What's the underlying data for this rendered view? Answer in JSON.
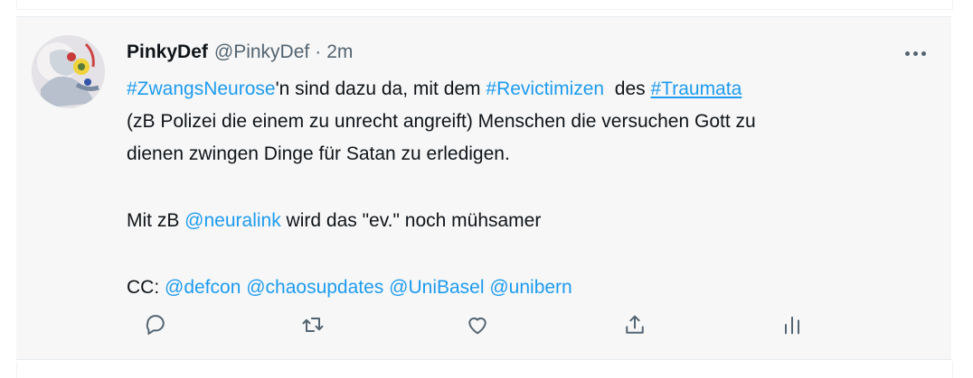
{
  "tweet": {
    "author_name": "PinkyDef",
    "author_handle": "@PinkyDef",
    "separator": "·",
    "time": "2m",
    "lines": [
      {
        "segments": [
          {
            "text": "#ZwangsNeurose",
            "link": true
          },
          {
            "text": "'n sind dazu da, mit dem "
          },
          {
            "text": "#Revictimizen",
            "link": true
          },
          {
            "text": "  des "
          },
          {
            "text": "#Traumata",
            "link": true,
            "underline": true
          }
        ]
      },
      {
        "segments": [
          {
            "text": "(zB Polizei die einem zu unrecht angreift) Menschen die versuchen Gott zu"
          }
        ]
      },
      {
        "segments": [
          {
            "text": "dienen zwingen Dinge für Satan zu erledigen."
          }
        ]
      },
      {
        "segments": []
      },
      {
        "segments": [
          {
            "text": "Mit zB "
          },
          {
            "text": "@neuralink",
            "link": true
          },
          {
            "text": " wird das \"ev.\" noch mühsamer"
          }
        ]
      },
      {
        "segments": []
      },
      {
        "segments": [
          {
            "text": "CC: "
          },
          {
            "text": "@defcon",
            "link": true
          },
          {
            "text": " "
          },
          {
            "text": "@chaosupdates",
            "link": true
          },
          {
            "text": " "
          },
          {
            "text": "@UniBasel",
            "link": true
          },
          {
            "text": " "
          },
          {
            "text": "@unibern",
            "link": true
          }
        ]
      }
    ]
  },
  "actions": [
    {
      "name": "reply-button",
      "icon": "reply-icon"
    },
    {
      "name": "retweet-button",
      "icon": "retweet-icon"
    },
    {
      "name": "like-button",
      "icon": "heart-icon"
    },
    {
      "name": "share-button",
      "icon": "share-icon"
    },
    {
      "name": "analytics-button",
      "icon": "analytics-icon"
    }
  ],
  "colors": {
    "link": "#1d9bf0",
    "secondary_text": "#536471",
    "primary_text": "#0f1419",
    "tweet_background": "#f7f7f7"
  }
}
